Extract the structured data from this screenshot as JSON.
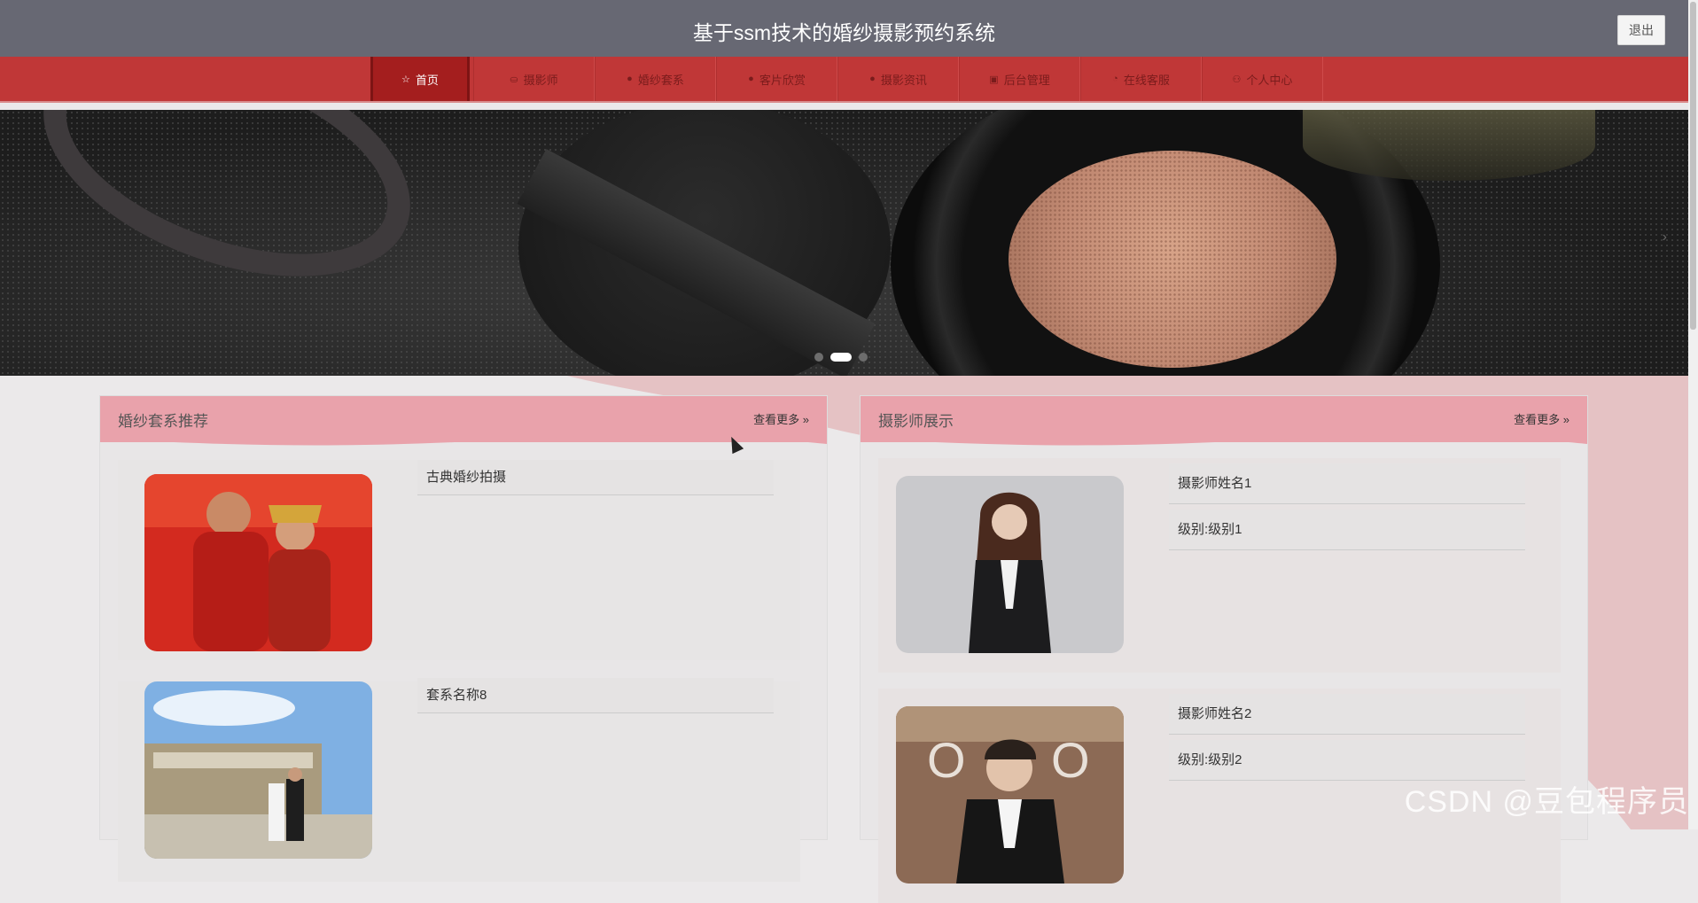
{
  "header": {
    "title": "基于ssm技术的婚纱摄影预约系统",
    "logout_label": "退出"
  },
  "nav": {
    "items": [
      {
        "label": "首页",
        "icon": "star-icon",
        "glyph": "☆"
      },
      {
        "label": "摄影师",
        "icon": "bag-icon",
        "glyph": "⛀"
      },
      {
        "label": "婚纱套系",
        "icon": "info-icon",
        "glyph": "●"
      },
      {
        "label": "客片欣赏",
        "icon": "question-icon",
        "glyph": "●"
      },
      {
        "label": "摄影资讯",
        "icon": "info-icon",
        "glyph": "●"
      },
      {
        "label": "后台管理",
        "icon": "briefcase-icon",
        "glyph": "▣"
      },
      {
        "label": "在线客服",
        "icon": "headset-icon",
        "glyph": "◔"
      },
      {
        "label": "个人中心",
        "icon": "user-icon",
        "glyph": "⚇"
      }
    ]
  },
  "banner": {
    "slide_count": 3,
    "active_index": 1
  },
  "packages": {
    "title": "婚纱套系推荐",
    "more_label": "查看更多",
    "items": [
      {
        "name": "古典婚纱拍摄"
      },
      {
        "name": "套系名称8"
      }
    ]
  },
  "photographers": {
    "title": "摄影师展示",
    "more_label": "查看更多",
    "items": [
      {
        "name": "摄影师姓名1",
        "level": "级别:级别1"
      },
      {
        "name": "摄影师姓名2",
        "level": "级别:级别2"
      }
    ]
  },
  "watermark": "CSDN @豆包程序员",
  "colors": {
    "topbar": "#676873",
    "nav": "#c03737",
    "nav_active": "#a41e1e",
    "panel_head": "#e9a2ab"
  }
}
